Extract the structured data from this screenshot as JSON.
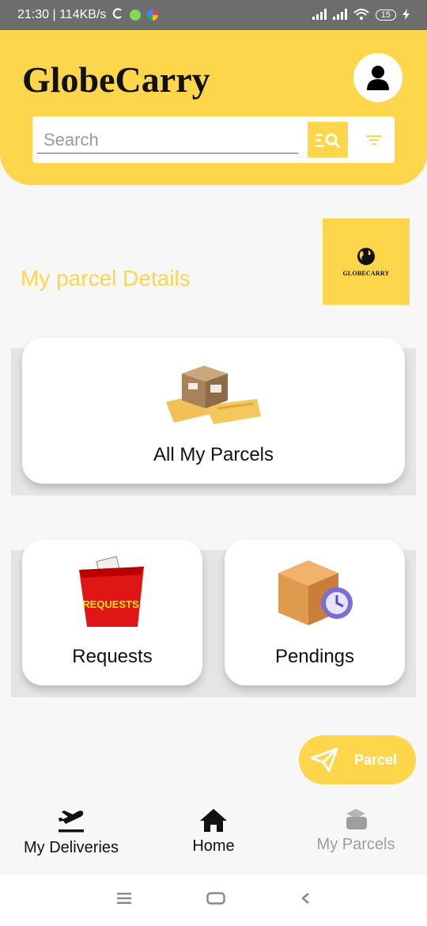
{
  "status_bar": {
    "time_speed": "21:30 | 114KB/s",
    "battery": "15"
  },
  "header": {
    "brand": "GlobeCarry"
  },
  "search": {
    "placeholder": "Search"
  },
  "section": {
    "title": "My parcel Details"
  },
  "logo": {
    "text": "GLOBECARRY"
  },
  "cards": {
    "all_parcels": "All My Parcels",
    "requests": "Requests",
    "requests_art_text": "REQUESTS",
    "pendings": "Pendings"
  },
  "fab": {
    "label": "Parcel"
  },
  "bottom_nav": {
    "deliveries": "My Deliveries",
    "home": "Home",
    "parcels": "My Parcels"
  },
  "colors": {
    "accent": "#fdd64c",
    "inactive": "#9e9e9e"
  }
}
